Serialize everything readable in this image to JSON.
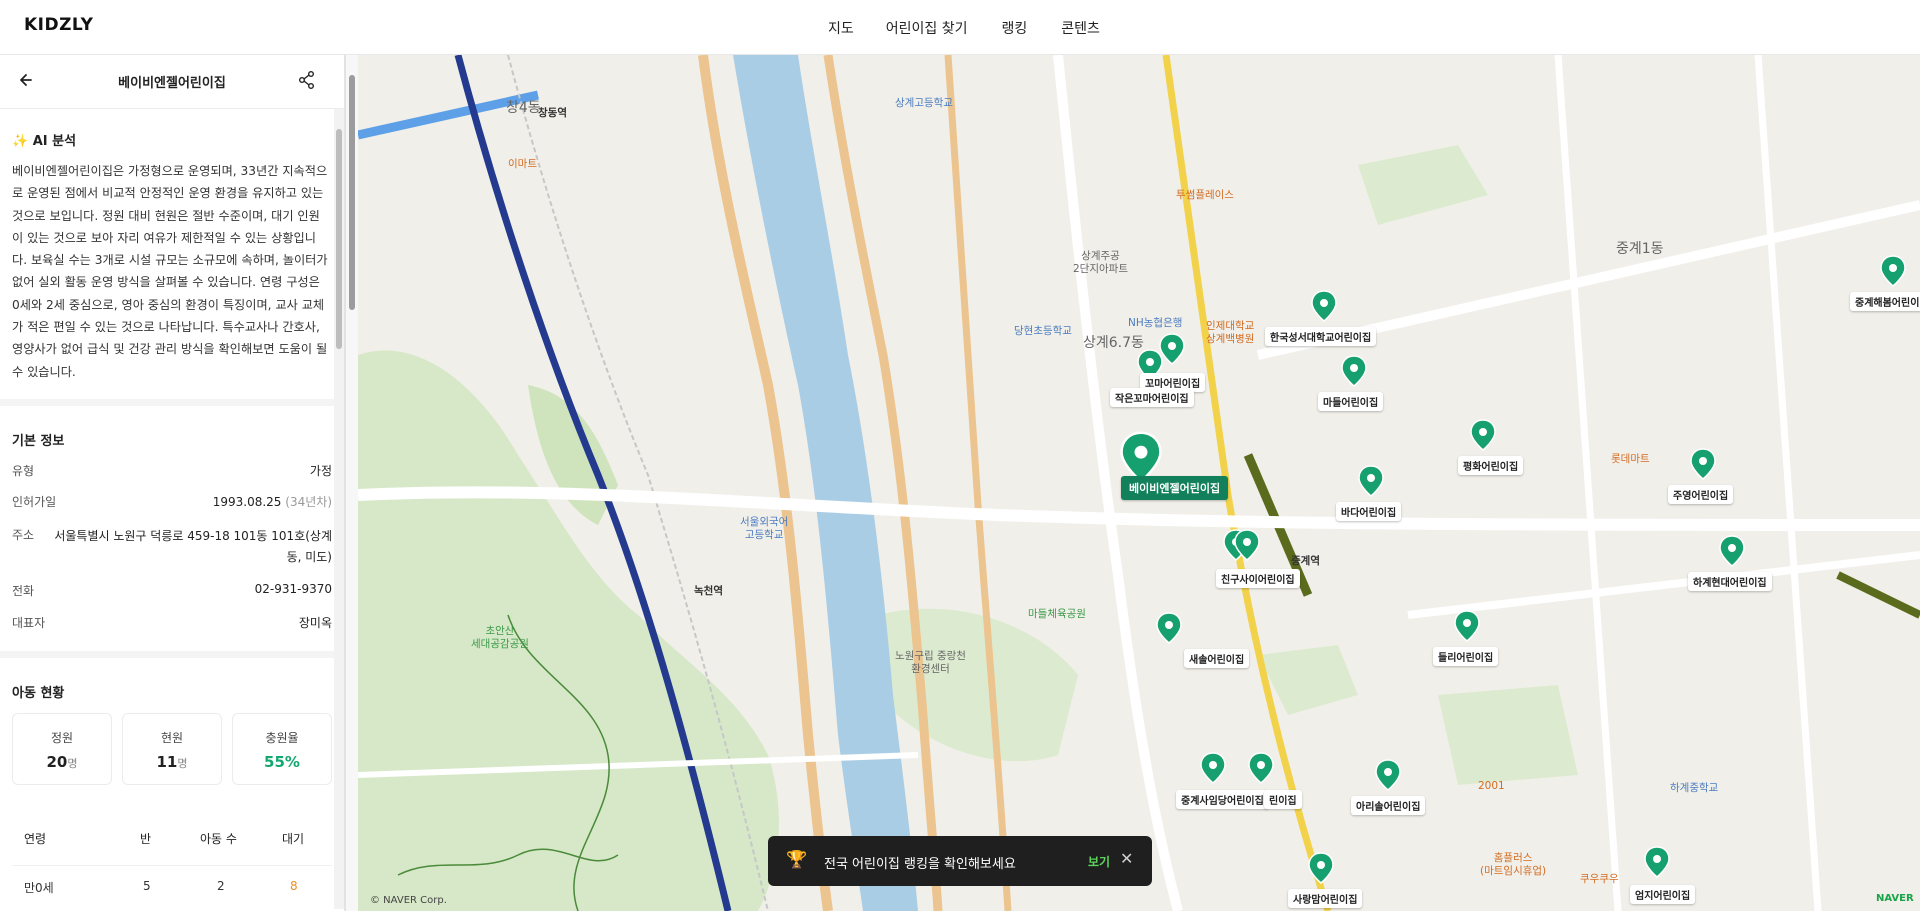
{
  "app": {
    "logo": "KIDZLY"
  },
  "nav": {
    "items": [
      "지도",
      "어린이집 찾기",
      "랭킹",
      "콘텐츠"
    ]
  },
  "panel": {
    "title": "베이비엔젤어린이집",
    "ai": {
      "title": "✨ AI 분석",
      "text": "베이비엔젤어린이집은 가정형으로 운영되며, 33년간 지속적으로 운영된 점에서 비교적 안정적인 운영 환경을 유지하고 있는 것으로 보입니다. 정원 대비 현원은 절반 수준이며, 대기 인원이 있는 것으로 보아 자리 여유가 제한적일 수 있는 상황입니다. 보육실 수는 3개로 시설 규모는 소규모에 속하며, 놀이터가 없어 실외 활동 운영 방식을 살펴볼 수 있습니다. 연령 구성은 0세와 2세 중심으로, 영아 중심의 환경이 특징이며, 교사 교체가 적은 편일 수 있는 것으로 나타납니다. 특수교사나 간호사, 영양사가 없어 급식 및 건강 관리 방식을 확인해보면 도움이 될 수 있습니다."
    },
    "basic": {
      "title": "기본 정보",
      "type_label": "유형",
      "type_value": "가정",
      "approved_label": "인허가일",
      "approved_value": "1993.08.25",
      "approved_years": "(34년차)",
      "address_label": "주소",
      "address_value": "서울특별시 노원구 덕릉로 459-18 101동 101호(상계동, 미도)",
      "phone_label": "전화",
      "phone_value": "02-931-9370",
      "rep_label": "대표자",
      "rep_value": "장미옥"
    },
    "kids": {
      "title": "아동 현황",
      "stats": [
        {
          "label": "정원",
          "value": "20",
          "unit": "명"
        },
        {
          "label": "현원",
          "value": "11",
          "unit": "명"
        },
        {
          "label": "충원율",
          "value": "55%"
        }
      ],
      "columns": [
        "연령",
        "반",
        "아동 수",
        "대기"
      ],
      "rows": [
        {
          "age": "만0세",
          "classes": "5",
          "children": "2",
          "waiting": "8"
        }
      ]
    }
  },
  "map": {
    "markers": [
      {
        "label": "베이비엔젤어린이집",
        "selected": true
      },
      {
        "label": "꼬마어린이집"
      },
      {
        "label": "작은꼬마어린이집"
      },
      {
        "label": "한국성서대학교어린이집"
      },
      {
        "label": "마들어린이집"
      },
      {
        "label": "평화어린이집"
      },
      {
        "label": "주영어린이집"
      },
      {
        "label": "중계해봄어린이"
      },
      {
        "label": "바다어린이집"
      },
      {
        "label": "친구사이어린이집"
      },
      {
        "label": "하계현대어린이집"
      },
      {
        "label": "새솔어린이집"
      },
      {
        "label": "들리어린이집"
      },
      {
        "label": "중계사임당어린이집"
      },
      {
        "label": "린이집"
      },
      {
        "label": "아리솔어린이집"
      },
      {
        "label": "사랑맘어린이집"
      },
      {
        "label": "엄지어린이집"
      }
    ],
    "places": {
      "changdong_station": "창동역",
      "nokcheon_station": "녹천역",
      "junggye_station": "중계역",
      "sanggye67": "상계6.7동",
      "changdong4": "창4동",
      "junggye1": "중계1동",
      "emart": "이마트",
      "lottemart": "롯데마트",
      "sanggye_highschool": "상계고등학교",
      "nowon_center": "노원구립 중랑천\n환경센터",
      "madeul_park": "마들체육공원",
      "chanan_park": "초안산\n세대공감공원",
      "nh_bank": "NH농협은행",
      "inje_hospital": "인제대학교\n상계백병원",
      "toosung": "투썸플레이스",
      "sanggye_apt": "상계주공\n2단지아파트",
      "dangcheon_school": "당현초등학교",
      "seoul_foreign": "서울외국어\n고등학교",
      "hagye_middle": "하계중학교",
      "homeplus": "홈플러스\n(마트임시휴업)",
      "kueku": "쿠우쿠우",
      "store2001": "2001"
    },
    "copyright": "© NAVER Corp.",
    "brand": "NAVER"
  },
  "toast": {
    "message": "전국 어린이집 랭킹을 확인해보세요",
    "action": "보기"
  },
  "colors": {
    "accent": "#12805a",
    "marker": "#16a06f",
    "green_text": "#0e9b6a"
  }
}
